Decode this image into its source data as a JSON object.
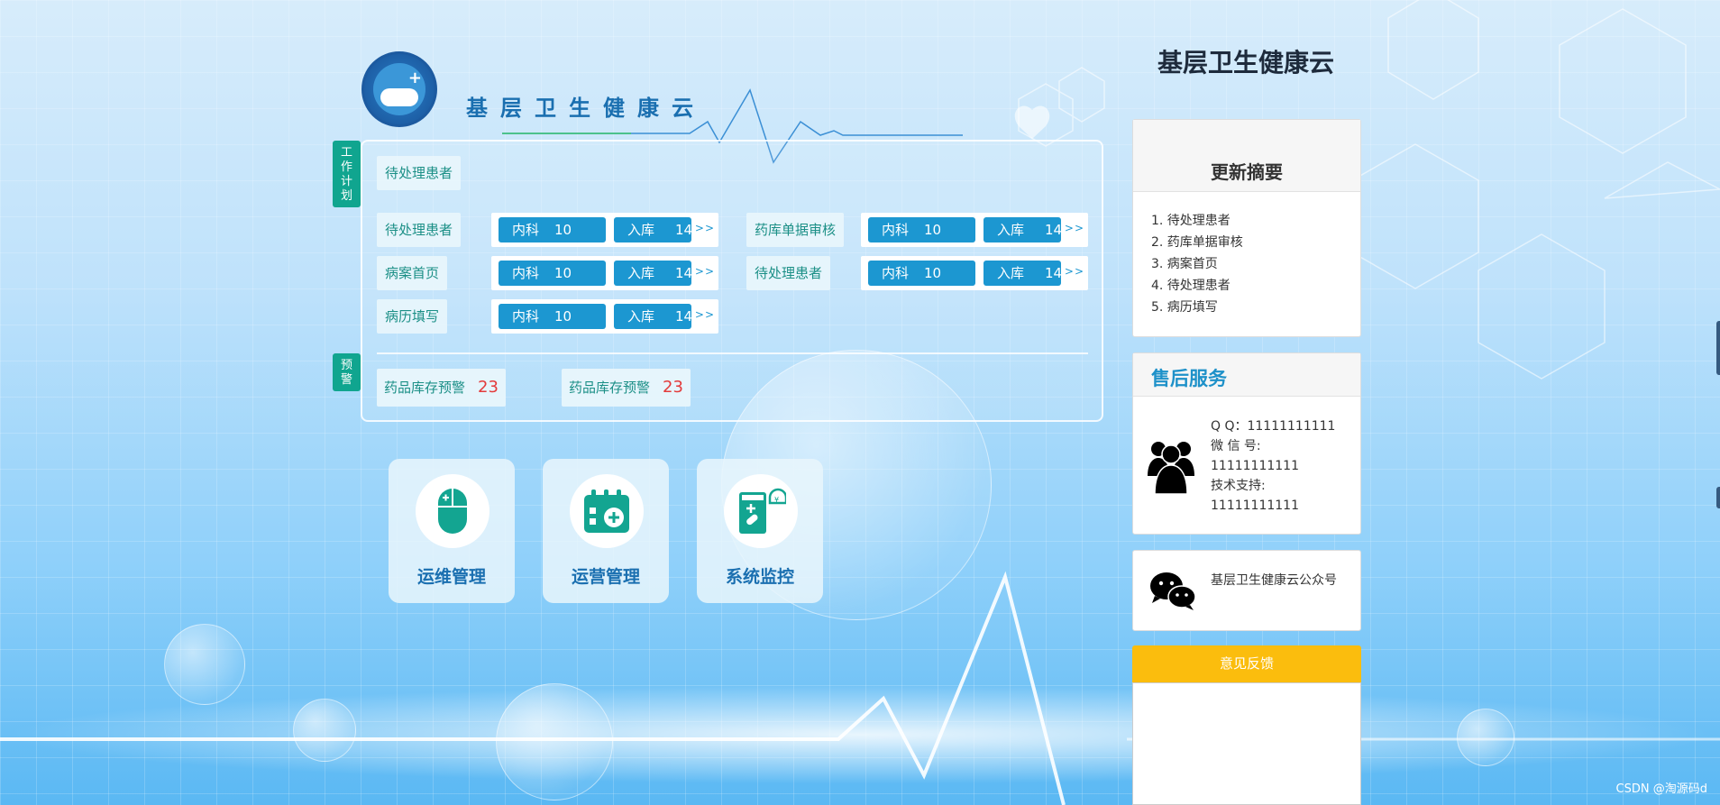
{
  "header": {
    "title": "基层卫生健康云"
  },
  "side_tags": {
    "work_plan": "工作计划",
    "warning": "预警"
  },
  "work_plan": {
    "top_chip": "待处理患者",
    "rows": [
      {
        "label": "待处理患者",
        "pill_a_label": "内科",
        "pill_a_value": "10",
        "pill_b_label": "入库",
        "pill_b_value": "14",
        "more": ">>"
      },
      {
        "label": "药库单据审核",
        "pill_a_label": "内科",
        "pill_a_value": "10",
        "pill_b_label": "入库",
        "pill_b_value": "14",
        "more": ">>"
      },
      {
        "label": "病案首页",
        "pill_a_label": "内科",
        "pill_a_value": "10",
        "pill_b_label": "入库",
        "pill_b_value": "14",
        "more": ">>"
      },
      {
        "label": "待处理患者",
        "pill_a_label": "内科",
        "pill_a_value": "10",
        "pill_b_label": "入库",
        "pill_b_value": "14",
        "more": ">>"
      },
      {
        "label": "病历填写",
        "pill_a_label": "内科",
        "pill_a_value": "10",
        "pill_b_label": "入库",
        "pill_b_value": "14",
        "more": ">>"
      }
    ]
  },
  "warnings": [
    {
      "label": "药品库存预警",
      "count": "23"
    },
    {
      "label": "药品库存预警",
      "count": "23"
    }
  ],
  "tiles": [
    {
      "label": "运维管理",
      "icon": "mouse-plus-icon"
    },
    {
      "label": "运营管理",
      "icon": "calendar-plus-icon"
    },
    {
      "label": "系统监控",
      "icon": "medicine-box-icon"
    }
  ],
  "sidebar": {
    "title": "基层卫生健康云",
    "summary": {
      "heading": "更新摘要",
      "items": [
        "1. 待处理患者",
        "2. 药库单据审核",
        "3. 病案首页",
        "4. 待处理患者",
        "5. 病历填写"
      ]
    },
    "service": {
      "heading": "售后服务",
      "qq": "Q Q：11111111111",
      "wechat_label": "微 信 号:",
      "wechat_value": "11111111111",
      "support_label": "技术支持:",
      "support_value": "11111111111"
    },
    "wechat_account": "基层卫生健康云公众号",
    "feedback": {
      "heading": "意见反馈",
      "value": ""
    }
  },
  "credit": "CSDN @淘源码d",
  "colors": {
    "accent_teal": "#10a58f",
    "pill_blue": "#1c97d1",
    "warning_red": "#e33b3b",
    "feedback_yellow": "#fbbd0d",
    "title_blue": "#1a6fb0"
  }
}
